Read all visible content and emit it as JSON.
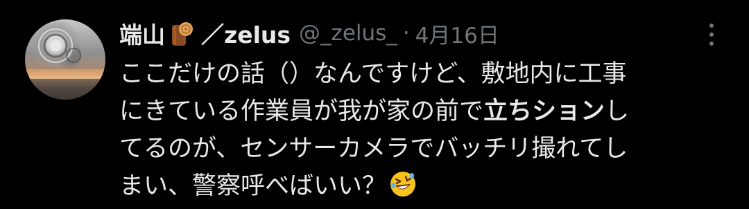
{
  "post": {
    "display_name": "端山",
    "display_name_icon": "log-emoji",
    "display_name_suffix": "／zelus",
    "handle": "@_zelus_",
    "separator": "·",
    "date": "4月16日",
    "menu_icon": "more-vertical-icon",
    "text_lines": [
      "ここだけの話（）なんですけど、敷地内に工事",
      "にきている作業員が我が家の前で",
      "立ちション",
      "し",
      "てるのが、センサーカメラでバッチリ撮れてし",
      "まい、警察呼べばいい？"
    ],
    "trailing_emoji": "rolling-on-floor-laughing-emoji"
  },
  "colors": {
    "background": "#000000",
    "text_primary": "#e7e9ea",
    "text_secondary": "#71767b"
  }
}
